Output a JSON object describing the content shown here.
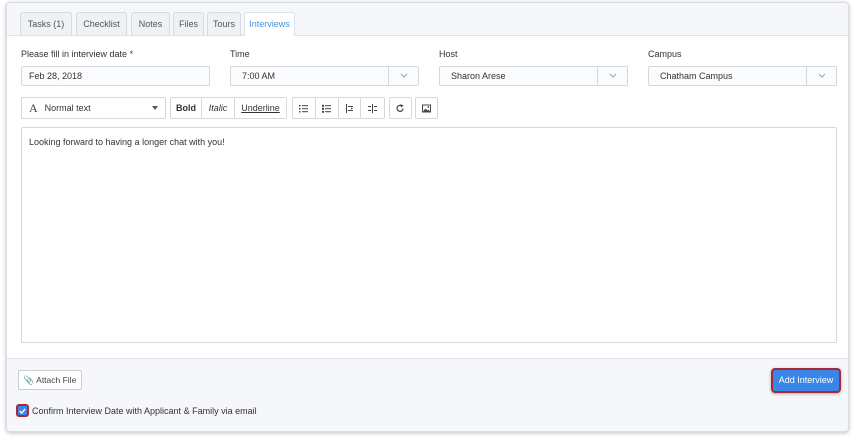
{
  "tabs": [
    {
      "label": "Tasks (1)"
    },
    {
      "label": "Checklist"
    },
    {
      "label": "Notes"
    },
    {
      "label": "Files"
    },
    {
      "label": "Tours"
    },
    {
      "label": "Interviews"
    }
  ],
  "form": {
    "date_label": "Please fill in interview date",
    "required_mark": "*",
    "date_value": "Feb 28, 2018",
    "time_label": "Time",
    "time_value": "7:00 AM",
    "host_label": "Host",
    "host_value": "Sharon Arese",
    "campus_label": "Campus",
    "campus_value": "Chatham Campus"
  },
  "toolbar": {
    "style_value": "Normal text",
    "style_glyph": "A",
    "bold": "Bold",
    "italic": "Italic",
    "underline": "Underline"
  },
  "editor": {
    "text": "Looking forward to having a longer chat with you!"
  },
  "footer": {
    "attach_label": "📎 Attach File",
    "add_label": "Add Interview",
    "confirm_label": "Confirm Interview Date with Applicant & Family via email",
    "confirm_checked": true
  },
  "colors": {
    "accent": "#3a86e8",
    "active_tab_text": "#4a90d9",
    "highlight": "#a8283a"
  }
}
